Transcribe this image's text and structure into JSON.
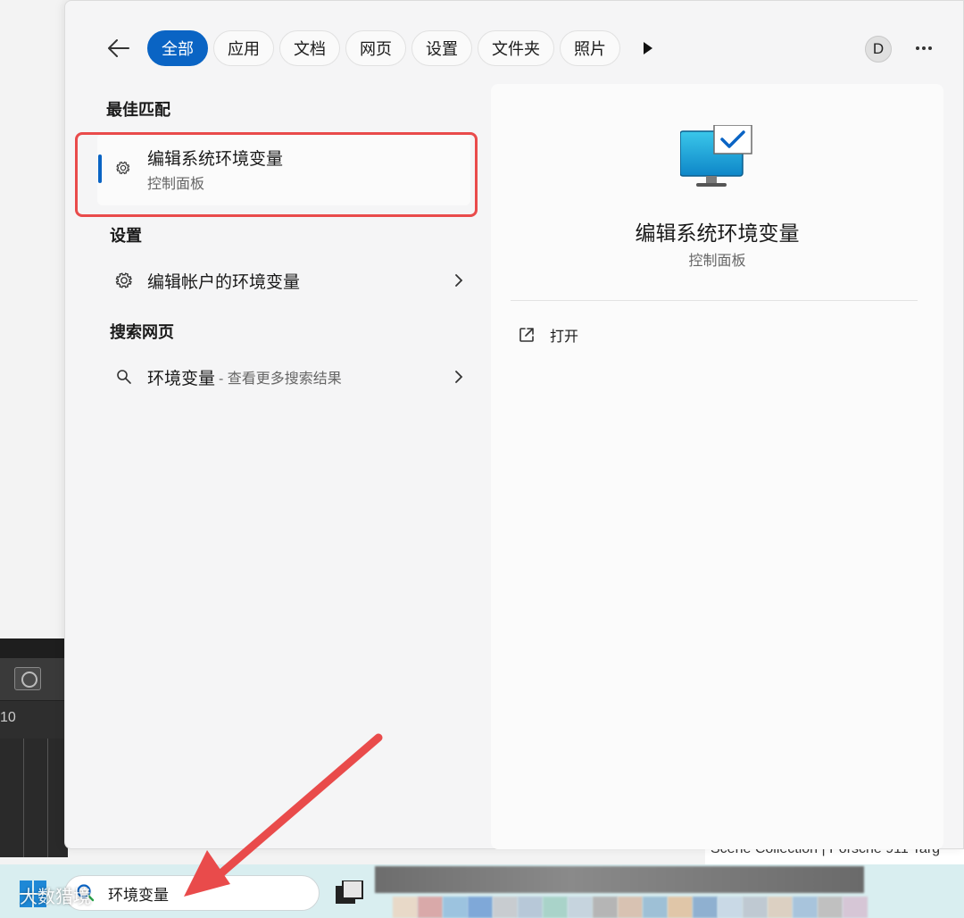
{
  "filters": {
    "back_icon": "back-arrow-icon",
    "chips": [
      "全部",
      "应用",
      "文档",
      "网页",
      "设置",
      "文件夹",
      "照片"
    ],
    "active_index": 0,
    "more_icon": "play-triangle-icon"
  },
  "account": {
    "avatar_letter": "D",
    "menu_icon": "more-dots-icon"
  },
  "best_match": {
    "section": "最佳匹配",
    "title": "编辑系统环境变量",
    "subtitle": "控制面板",
    "icon": "gear-icon"
  },
  "settings": {
    "section": "设置",
    "items": [
      {
        "label": "编辑帐户的环境变量",
        "icon": "gear-icon"
      }
    ]
  },
  "web": {
    "section": "搜索网页",
    "items": [
      {
        "label": "环境变量",
        "sub": "- 查看更多搜索结果",
        "icon": "search-icon"
      }
    ]
  },
  "detail": {
    "title": "编辑系统环境变量",
    "subtitle": "控制面板",
    "icon": "monitor-checkmark-icon",
    "actions": [
      {
        "label": "打开",
        "icon": "open-external-icon"
      }
    ]
  },
  "taskbar": {
    "search_text": "环境变量",
    "start_icon": "windows-start-icon"
  },
  "background": {
    "ruler_text": "10",
    "strip_text": "Scene Collection | Porsche 911 Targ"
  },
  "annotation": {
    "watermark": "大数猎境",
    "color": "#e94b4b"
  },
  "colors": {
    "accent": "#0a64c4",
    "highlight_box": "#e94b4b",
    "taskbar": "#d9eef0"
  }
}
